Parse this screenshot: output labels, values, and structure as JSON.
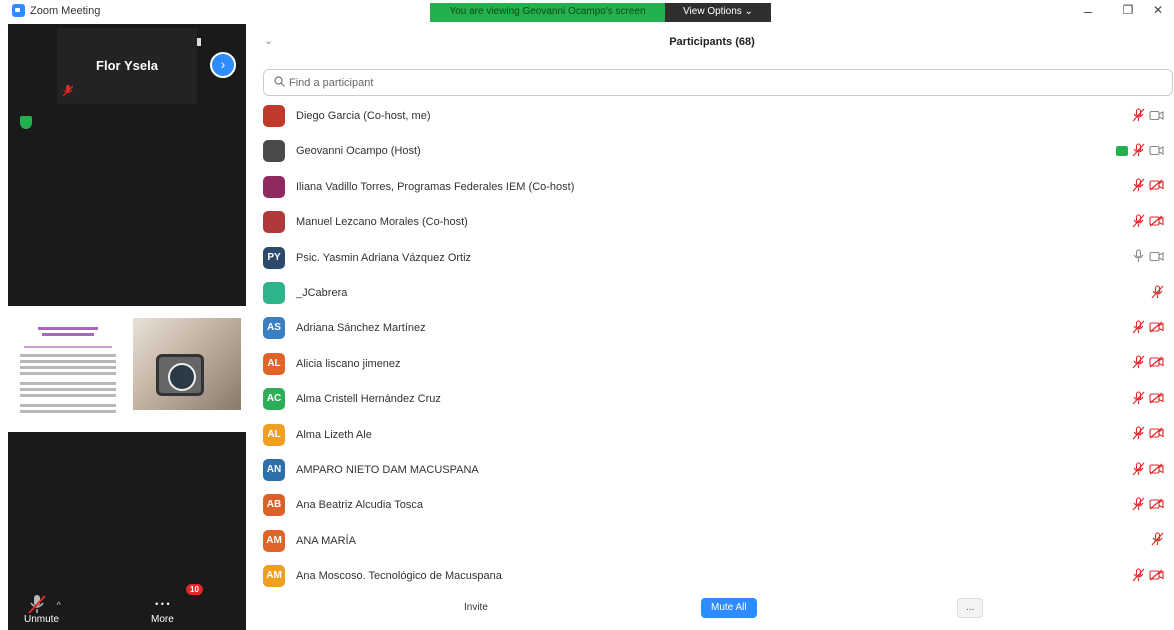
{
  "window": {
    "title": "Zoom Meeting",
    "minimize": "–",
    "restore": "❐",
    "close": "✕"
  },
  "share_banner": {
    "message": "You are viewing Geovanni Ocampo's screen",
    "view_options": "View Options ⌄"
  },
  "video": {
    "tile_name": "Flor Ysela",
    "next_page": "›"
  },
  "controls": {
    "unmute_label": "Unmute",
    "more_label": "More",
    "more_badge": "10",
    "more_dots": "• • •"
  },
  "participants": {
    "collapse": "⌄",
    "title": "Participants (68)",
    "search_placeholder": "Find a participant",
    "rows": [
      {
        "name": "Diego Garcia (Co-host, me)",
        "initials": "",
        "color": "#c0392b",
        "mic": "muted",
        "cam": "on"
      },
      {
        "name": "Geovanni Ocampo (Host)",
        "initials": "",
        "color": "#4a4a4a",
        "mic": "muted",
        "cam": "on",
        "sharing": true
      },
      {
        "name": "Iliana Vadillo Torres, Programas Federales IEM (Co-host)",
        "initials": "",
        "color": "#8e2a5e",
        "mic": "muted",
        "cam": "off"
      },
      {
        "name": "Manuel Lezcano Morales (Co-host)",
        "initials": "",
        "color": "#b03a3a",
        "mic": "muted",
        "cam": "off"
      },
      {
        "name": "Psic. Yasmin Adriana Vázquez Ortiz",
        "initials": "PY",
        "color": "#2c4a6e",
        "mic": "on",
        "cam": "on"
      },
      {
        "name": "_JCabrera",
        "initials": "",
        "color": "#2fb38a",
        "mic": "muted",
        "cam": "none"
      },
      {
        "name": "Adriana Sánchez Martínez",
        "initials": "AS",
        "color": "#3a7fc1",
        "mic": "muted",
        "cam": "off"
      },
      {
        "name": "Alicia liscano jimenez",
        "initials": "AL",
        "color": "#e0632a",
        "mic": "muted",
        "cam": "off"
      },
      {
        "name": "Alma Cristell Hernández Cruz",
        "initials": "AC",
        "color": "#2fae5a",
        "mic": "muted",
        "cam": "off"
      },
      {
        "name": "Alma Lizeth Ale",
        "initials": "AL",
        "color": "#f0a020",
        "mic": "muted",
        "cam": "off"
      },
      {
        "name": "AMPARO NIETO DAM MACUSPANA",
        "initials": "AN",
        "color": "#2d6fa8",
        "mic": "muted",
        "cam": "off"
      },
      {
        "name": "Ana Beatriz Alcudia Tosca",
        "initials": "AB",
        "color": "#d9622b",
        "mic": "muted",
        "cam": "off"
      },
      {
        "name": "ANA MARÍA",
        "initials": "AM",
        "color": "#e0632a",
        "mic": "muted",
        "cam": "none"
      },
      {
        "name": "Ana Moscoso. Tecnológico de Macuspana",
        "initials": "AM",
        "color": "#f0a020",
        "mic": "muted",
        "cam": "off"
      }
    ],
    "invite": "Invite",
    "mute_all": "Mute All",
    "more": "..."
  },
  "colors": {
    "accent": "#2d8cff",
    "muted_red": "#e02828",
    "share_green": "#22b14c",
    "panel_dark": "#1a1a1a"
  },
  "icons": {
    "mute": "mic-off-icon",
    "camera": "camera-icon",
    "camera_off": "camera-off-icon",
    "search": "search-icon",
    "shield": "shield-icon"
  }
}
